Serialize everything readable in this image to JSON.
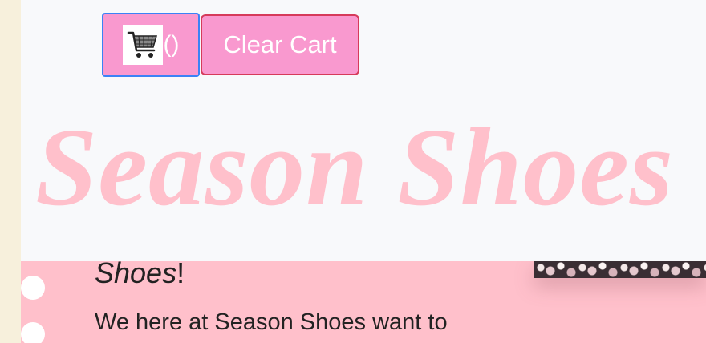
{
  "cart": {
    "count_text": "()",
    "clear_label": "Clear Cart"
  },
  "brand": {
    "title": "Season Shoes"
  },
  "intro": {
    "shoes_word": "Shoes",
    "exclaim": "!",
    "text": "We here at Season Shoes want to"
  },
  "icons": {
    "cart": "shopping-cart-icon",
    "bullet": "bullet-dot"
  },
  "colors": {
    "button_pink": "#f999cf",
    "title_pink": "#ffc0cb",
    "content_pink": "#ffc0cb",
    "cart_border": "#3b82f6",
    "clear_border": "#d63b5b",
    "left_strip": "#f7f0dc"
  }
}
